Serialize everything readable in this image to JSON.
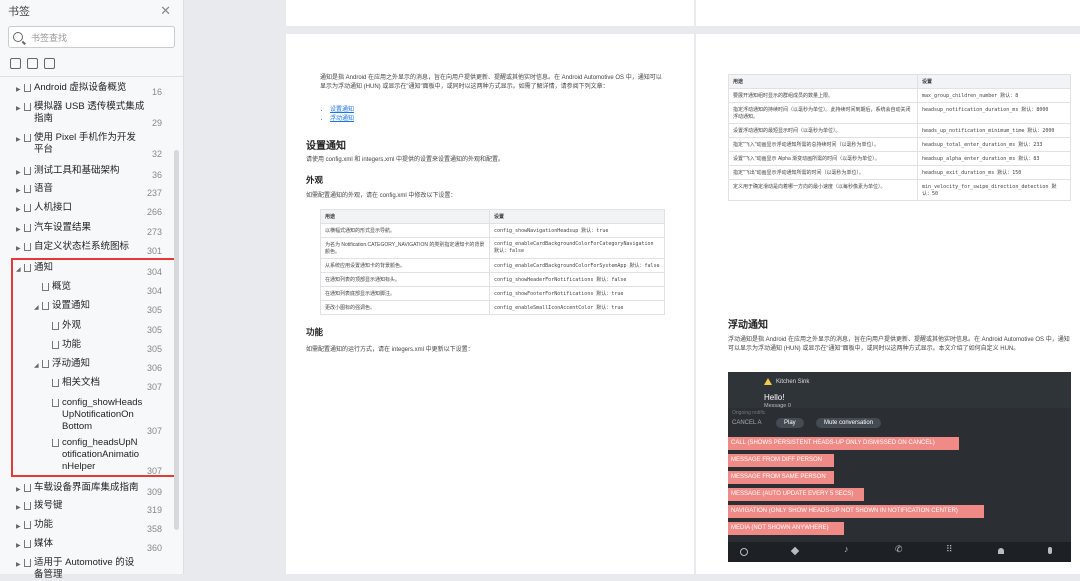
{
  "sidebar": {
    "title": "书签",
    "close_icon": "close-icon",
    "search_placeholder": "书签查找",
    "toc": [
      {
        "label": "Android 虚拟设备概览",
        "page": "16"
      },
      {
        "label": "模拟器 USB 透传模式集成",
        "label2": "指南",
        "page": "29"
      },
      {
        "label": "使用 Pixel 手机作为开发",
        "label2": "平台",
        "page": "32"
      },
      {
        "label": "测试工具和基础架构",
        "page": "36"
      },
      {
        "label": "语音",
        "page": "237"
      },
      {
        "label": "人机接口",
        "page": "266"
      },
      {
        "label": "汽车设置结果",
        "page": "273"
      },
      {
        "label": "自定义状态栏系统图标",
        "page": "301"
      },
      {
        "label": "通知",
        "page": "304"
      },
      {
        "label": "概览",
        "page": "304"
      },
      {
        "label": "设置通知",
        "page": "305"
      },
      {
        "label": "外观",
        "page": "305"
      },
      {
        "label": "功能",
        "page": "305"
      },
      {
        "label": "浮动通知",
        "page": "306"
      },
      {
        "label": "相关文档",
        "page": "307"
      },
      {
        "label": "config_showHeads",
        "label2": "UpNotificationOn",
        "label3": "Bottom",
        "page": "307"
      },
      {
        "label": "config_headsUpN",
        "label2": "otificationAnimatio",
        "label3": "nHelper",
        "page": "307"
      },
      {
        "label": "车载设备界面库集成指南",
        "page": "309"
      },
      {
        "label": "拨号键",
        "page": "319"
      },
      {
        "label": "功能",
        "page": "358"
      },
      {
        "label": "媒体",
        "page": "360"
      },
      {
        "label": "适用于 Automotive 的设",
        "label2": "备管理",
        "page": ""
      }
    ]
  },
  "left_page": {
    "intro": "通知是指 Android 在应用之外显示的消息，旨在向用户提供更新、提醒或其他实时信息。在 Android Automotive OS 中，通知可以显示为浮动通知 (HUN) 或显示在\"通知\"面板中，或同时以这两种方式显示。如需了解详情，请参阅下列文章：",
    "links": [
      "设置通知",
      "浮动通知"
    ],
    "h_setup": "设置通知",
    "setup_text": "请使用 config.xml 和 integers.xml 中提供的设置来设置通知的外观和配置。",
    "h_appearance": "外观",
    "appearance_text": "如需配置通知的外观，请在 config.xml 中修改以下设置：",
    "table_headers": [
      "用途",
      "设置"
    ],
    "table": [
      [
        "以横幅式通知的形式显示导航。",
        "config_showNavigationHeadsup 默认：true"
      ],
      [
        "为名为 Notification.CATEGORY_NAVIGATION 的类别指定通知卡的背景颜色。",
        "config_enableCardBackgroundColorForCategoryNavigation 默认：false"
      ],
      [
        "从系统应用设置通知卡的背景颜色。",
        "config_enableCardBackgroundColorForSystemApp 默认：false"
      ],
      [
        "在通知列表的顶部显示通知标头。",
        "config_showHeaderForNotifications 默认：false"
      ],
      [
        "在通知列表底部显示通知脚注。",
        "config_showFooterForNotifications 默认：true"
      ],
      [
        "更改小图标的强调色。",
        "config_enableSmallIconAccentColor 默认：true"
      ]
    ],
    "h_function": "功能",
    "function_text": "如需配置通知的运行方式，请在 integers.xml 中更新以下设置："
  },
  "right_page": {
    "table_headers": [
      "用途",
      "设置"
    ],
    "table": [
      [
        "要展开通知组时显示的群组成员的数量上限。",
        "max_group_children_number 默认：8"
      ],
      [
        "指定浮动通知的持续时间（以毫秒为单位）。此持续时间到期后，系统会自动关闭浮动通知。",
        "headsup_notification_duration_ms 默认：8000"
      ],
      [
        "设置浮动通知的最短显示时间（以毫秒为单位）。",
        "heads_up_notification_minimum_time 默认：2000"
      ],
      [
        "指定\"飞入\"动画显示浮动通知所需的总持续时间（以毫秒为单位）。",
        "headsup_total_enter_duration_ms 默认：233"
      ],
      [
        "设置\"飞入\"动画显示 Alpha 渐变动画所需的时间（以毫秒为单位）。",
        "headsup_alpha_enter_duration_ms 默认：83"
      ],
      [
        "指定\"飞出\"动画显示浮动通知所需的时间（以毫秒为单位）。",
        "headsup_exit_duration_ms 默认：150"
      ],
      [
        "定义用于确定滑动是向着哪一方向的最小速度（以每秒像素为单位）。",
        "min_velocity_for_swipe_direction_detection 默认：50"
      ]
    ],
    "h_hun": "浮动通知",
    "hun_text": "浮动通知是指 Android 在应用之外显示的消息，旨在向用户提供更新、提醒或其他实时信息。在 Android Automotive OS 中，通知可以显示为浮动通知 (HUN) 或显示在\"通知\"面板中，或同时以这两种方式显示。本文介绍了如何自定义 HUN。",
    "shot": {
      "app": "Kitchen Sink",
      "title": "Hello!",
      "msg": "Message 0",
      "btn_play": "Play",
      "btn_mute": "Mute conversation",
      "cancel": "CANCEL A",
      "ongoing": "Ongoing notific",
      "rows": [
        "CALL (SHOWS PERSISTENT HEADS-UP ONLY DISMISSED ON CANCEL)",
        "MESSAGE FROM DIFF PERSON",
        "MESSAGE FROM SAME PERSON",
        "MESSAGE (AUTO UPDATE EVERY 5 SECS)",
        "NAVIGATION (ONLY SHOW HEADS-UP NOT SHOWN IN NOTIFICATION CENTER)",
        "MEDIA (NOT SHOWN ANYWHERE)"
      ]
    }
  }
}
